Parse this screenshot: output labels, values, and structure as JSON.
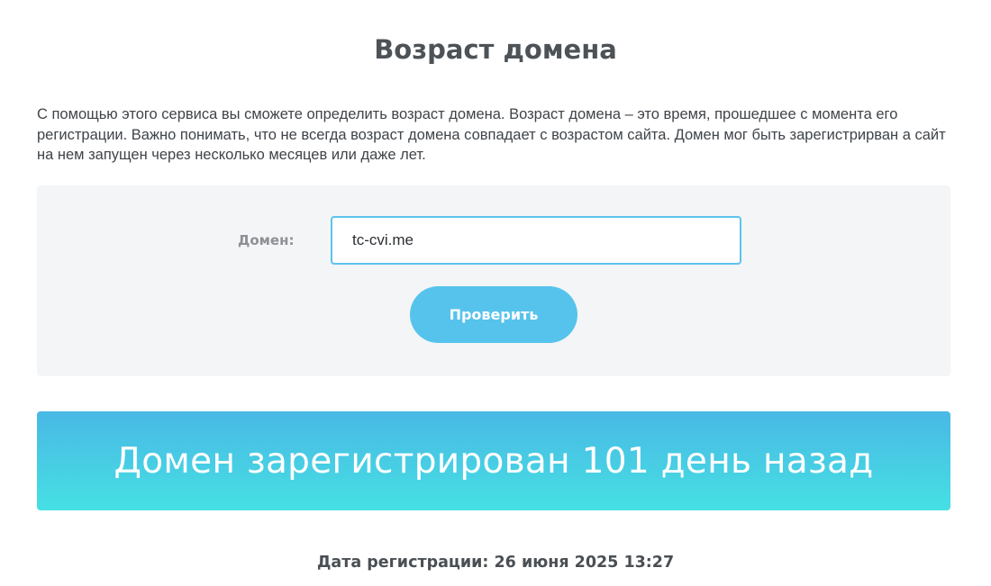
{
  "page": {
    "title": "Возраст домена",
    "intro": "С помощью этого сервиса вы сможете определить возраст домена. Возраст домена – это время, прошедшее с момента его регистрации. Важно понимать, что не всегда возраст домена совпадает с возрастом сайта. Домен мог быть зарегистрирван а сайт на нем запущен через несколько месяцев или даже лет."
  },
  "form": {
    "domain_label": "Домен:",
    "domain_value": "tc-cvi.me",
    "submit_label": "Проверить"
  },
  "result": {
    "message": "Домен зарегистрирован 101 день назад",
    "registration_date": "Дата регистрации: 26 июня 2025 13:27"
  },
  "colors": {
    "accent": "#56c3ec",
    "banner_top": "#49b8e5",
    "banner_bottom": "#46e0e4",
    "panel_background": "#f3f5f6",
    "text": "#4a4f54"
  }
}
